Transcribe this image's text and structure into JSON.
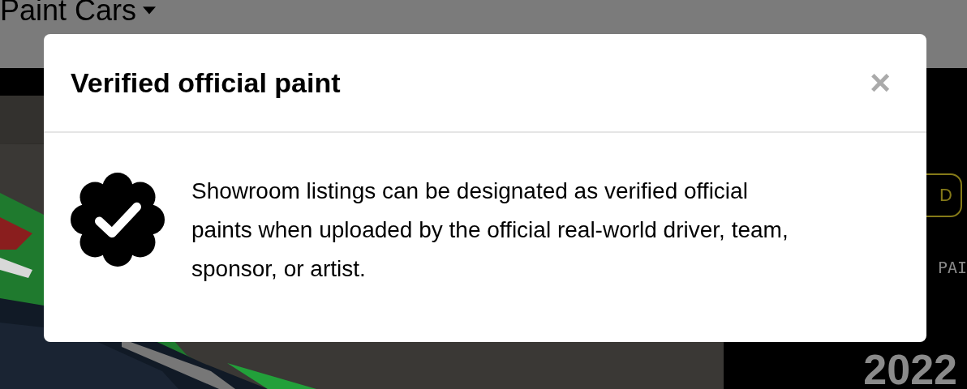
{
  "page": {
    "nav_title": "Paint Cars",
    "side_panel": {
      "button": "D",
      "label": "PAI",
      "year": "2022"
    }
  },
  "modal": {
    "title": "Verified official paint",
    "close": "×",
    "body": "Showroom listings can be designated as verified official paints when uploaded by the official real-world driver, team, sponsor, or artist."
  }
}
